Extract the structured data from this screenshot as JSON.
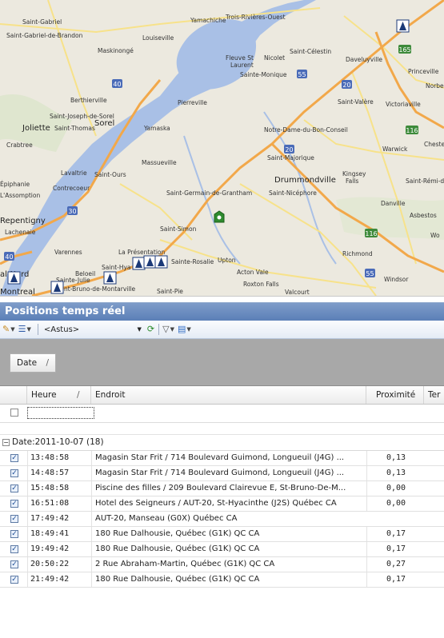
{
  "map": {
    "places": {
      "saint_gabriel": "Saint-Gabriel",
      "saint_gabriel_de_brandon": "Saint-Gabriel-de-Brandon",
      "louiseville": "Louiseville",
      "yamachiche": "Yamachiche",
      "trois_rivieres_ouest": "Trois-Rivières-Ouest",
      "maskinonge": "Maskinongé",
      "fleuve": "Fleuve St",
      "laurent": "Laurent",
      "nicolet": "Nicolet",
      "saint_celestin": "Saint-Célestin",
      "daveluyville": "Daveluyville",
      "sainte_monique": "Sainte-Monique",
      "princeville": "Princeville",
      "norbert": "Norber",
      "berthierville": "Berthierville",
      "pierreville": "Pierreville",
      "saint_valere": "Saint-Valère",
      "victoriaville": "Victoriaville",
      "saint_joseph_de_sorel": "Saint-Joseph-de-Sorel",
      "joliette": "Joliette",
      "saint_thomas": "Saint-Thomas",
      "sorel": "Sorel",
      "yamaska": "Yamaska",
      "notre_dame": "Notre-Dame-du-Bon-Conseil",
      "crabtree": "Crabtree",
      "warwick": "Warwick",
      "chester": "Cheste",
      "sainte_majorique": "Saint-Majorique",
      "massueville": "Massueville",
      "drummondville": "Drummondville",
      "kingsey_falls": "Kingsey",
      "kingsey_falls2": "Falls",
      "saint_remi": "Saint-Rémi-d",
      "lavaltrie": "Lavaltrie",
      "saint_ours": "Saint-Ours",
      "epiphanie": "Épiphanie",
      "contrecoeur": "Contrecoeur",
      "lassomption": "L'Assomption",
      "saint_germain": "Saint-Germain-de-Grantham",
      "saint_nicephore": "Saint-Nicéphore",
      "danville": "Danville",
      "asbestos": "Asbestos",
      "repentigny": "Repentigny",
      "lachenaie": "Lachenaie",
      "saint_simon": "Saint-Simon",
      "wo": "Wo",
      "varennes": "Varennes",
      "la_presentation": "La Présentation",
      "richmond": "Richmond",
      "saint_hyacinthe": "Saint-Hya",
      "sainte_rosalie": "Sainte-Rosalie",
      "upton": "Upton",
      "acton_vale": "Acton Vale",
      "val_nord": "al-Nord",
      "sainte_julie": "Sainte-Julie",
      "roxton_falls": "Roxton Falls",
      "beloeil": "Beloeil",
      "montreal": "Montreal",
      "saint_bruno": "nt-Bruno-de-Montarville",
      "saint_pie": "Saint-Pie",
      "windsor": "Windsor",
      "valcourt": "Valcourt"
    },
    "route_shields": {
      "r165": "165",
      "r40": "40",
      "r55a": "55",
      "r20a": "20",
      "r116a": "116",
      "r20b": "20",
      "r30": "30",
      "r116b": "116",
      "r40b": "40",
      "r55b": "55"
    },
    "colors": {
      "water": "#a9c0e6",
      "land": "#ece9df",
      "highway": "#f2a84a",
      "road": "#f7e28a",
      "route_shield": "#3d8a3a",
      "autoroute_shield": "#4a6bb8"
    }
  },
  "panel": {
    "title": "Positions temps réel",
    "toolbar": {
      "source_value": "<Astus>"
    },
    "group_by": {
      "label": "Date",
      "sort_glyph": "/"
    },
    "columns": {
      "heure": "Heure",
      "heure_sort": "/",
      "endroit": "Endroit",
      "proximite": "Proximité",
      "te": "Ter"
    },
    "group": {
      "toggle": "−",
      "label": "Date:2011-10-07 (18)"
    },
    "rows": [
      {
        "heure": "13:48:58",
        "endroit": "Magasin Star Frit / 714 Boulevard Guimond, Longueuil (J4G) ...",
        "proximite": "0,13"
      },
      {
        "heure": "14:48:57",
        "endroit": "Magasin Star Frit / 714 Boulevard Guimond, Longueuil (J4G) ...",
        "proximite": "0,13"
      },
      {
        "heure": "15:48:58",
        "endroit": "Piscine des filles / 209 Boulevard Clairevue E, St-Bruno-De-M...",
        "proximite": "0,00"
      },
      {
        "heure": "16:51:08",
        "endroit": "Hotel des Seigneurs / AUT-20, St-Hyacinthe (J2S) Québec CA",
        "proximite": "0,00"
      },
      {
        "heure": "17:49:42",
        "endroit": "AUT-20, Manseau (G0X) Québec CA",
        "proximite": ""
      },
      {
        "heure": "18:49:41",
        "endroit": "180 Rue Dalhousie, Québec (G1K) QC CA",
        "proximite": "0,17"
      },
      {
        "heure": "19:49:42",
        "endroit": "180 Rue Dalhousie, Québec (G1K) QC CA",
        "proximite": "0,17"
      },
      {
        "heure": "20:50:22",
        "endroit": "2 Rue Abraham-Martin, Québec (G1K) QC CA",
        "proximite": "0,27"
      },
      {
        "heure": "21:49:42",
        "endroit": "180 Rue Dalhousie, Québec (G1K) QC CA",
        "proximite": "0,17"
      }
    ]
  }
}
